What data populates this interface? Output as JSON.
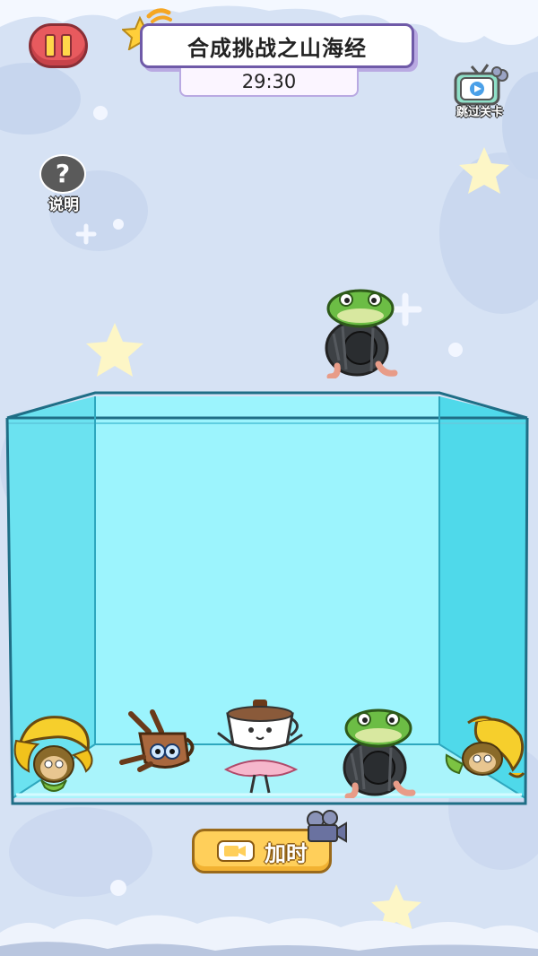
{
  "game": {
    "title": "合成挑战之山海经",
    "timer": "29:30"
  },
  "buttons": {
    "help_label": "说明",
    "help_symbol": "?",
    "skip_label": "跳过关卡",
    "add_time_label": "加时"
  },
  "pieces": [
    {
      "name": "frog-tire-character",
      "state": "falling"
    },
    {
      "name": "banana-monkey-character",
      "state": "in-box"
    },
    {
      "name": "coffee-pot-character",
      "state": "in-box"
    },
    {
      "name": "coffee-cup-ballerina-character",
      "state": "in-box"
    },
    {
      "name": "frog-tire-character",
      "state": "in-box"
    },
    {
      "name": "banana-monkey-character",
      "state": "in-box"
    }
  ],
  "colors": {
    "background": "#d6e2f4",
    "box_glass": "#8ff0fb",
    "pause_button": "#e85a5e",
    "add_time_button": "#ffcf5a",
    "title_border": "#6f5aa8"
  }
}
